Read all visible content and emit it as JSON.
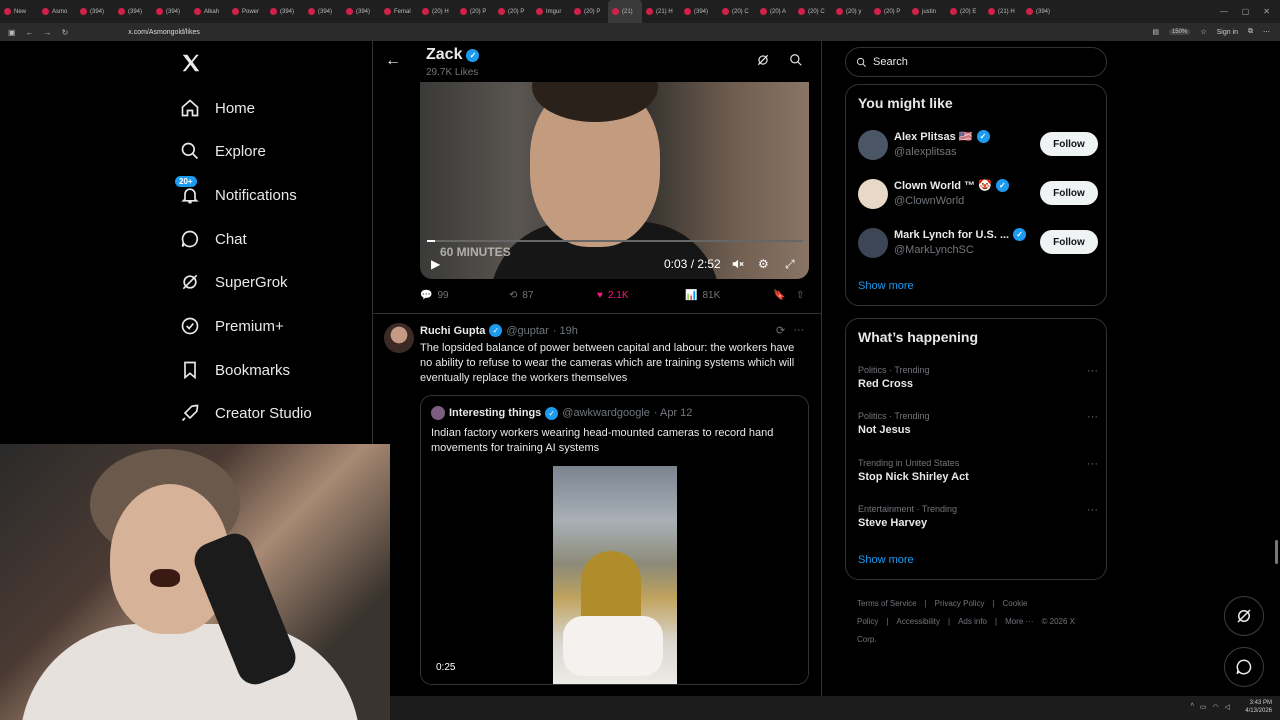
{
  "browser": {
    "tabs": [
      "New",
      "Asmo",
      "(394)",
      "(394)",
      "(394)",
      "Alkah",
      "Power",
      "(394)",
      "(394)",
      "(394)",
      "Femal",
      "(20) H",
      "(20) P",
      "(20) P",
      "Imgur",
      "(20) P",
      "(21)",
      "(21) H",
      "(394)",
      "(20) C",
      "(20) A",
      "(20) C",
      "(20) y",
      "(20) P",
      "justin",
      "(20) E",
      "(21) H",
      "(394)"
    ],
    "url": "x.com/Asmongold/likes",
    "zoom": "150%",
    "sign_in": "Sign in"
  },
  "sidebar": {
    "items": [
      {
        "label": "Home",
        "icon": "home-icon"
      },
      {
        "label": "Explore",
        "icon": "search-icon"
      },
      {
        "label": "Notifications",
        "icon": "bell-icon",
        "badge": "20+"
      },
      {
        "label": "Chat",
        "icon": "chat-icon"
      },
      {
        "label": "SuperGrok",
        "icon": "grok-icon"
      },
      {
        "label": "Premium+",
        "icon": "premium-icon"
      },
      {
        "label": "Bookmarks",
        "icon": "bookmark-icon"
      },
      {
        "label": "Creator Studio",
        "icon": "rocket-icon"
      }
    ]
  },
  "header": {
    "name": "Zack",
    "subtitle": "29.7K Likes"
  },
  "video1": {
    "time": "0:03 / 2:52",
    "watermark": "60 MINUTES",
    "progress": 0.02
  },
  "tweet1_actions": {
    "replies": "99",
    "reposts": "87",
    "likes": "2.1K",
    "views": "81K"
  },
  "tweet2": {
    "name": "Ruchi Gupta",
    "handle": "@guptar",
    "time": "· 19h",
    "text": "The lopsided balance of power between capital and labour: the workers have no ability to refuse to wear the cameras which are training systems which will eventually replace the workers themselves",
    "quote": {
      "name": "Interesting things",
      "handle": "@awkwardgoogle",
      "time": "· Apr 12",
      "text": "Indian factory workers wearing head-mounted cameras to record hand movements for training AI systems",
      "video_time": "0:25"
    }
  },
  "right": {
    "search_placeholder": "Search",
    "you_might_like": "You might like",
    "suggestions": [
      {
        "name": "Alex Plitsas 🇺🇸",
        "handle": "@alexplitsas",
        "follow": "Follow",
        "avatar_color": "#4a5565"
      },
      {
        "name": "Clown World ™ 🤡",
        "handle": "@ClownWorld",
        "follow": "Follow",
        "avatar_color": "#e8d9c6"
      },
      {
        "name": "Mark Lynch for U.S. ...",
        "handle": "@MarkLynchSC",
        "follow": "Follow",
        "avatar_color": "#3c4656"
      }
    ],
    "show_more": "Show more",
    "whats_happening": "What’s happening",
    "trends": [
      {
        "category": "Politics · Trending",
        "topic": "Red Cross"
      },
      {
        "category": "Politics · Trending",
        "topic": "Not Jesus"
      },
      {
        "category": "Trending in United States",
        "topic": "Stop Nick Shirley Act"
      },
      {
        "category": "Entertainment · Trending",
        "topic": "Steve Harvey"
      }
    ],
    "show_more_2": "Show more",
    "footer": [
      "Terms of Service",
      "|",
      "Privacy Policy",
      "|",
      "Cookie Policy",
      "|",
      "Accessibility",
      "|",
      "Ads info",
      "|",
      "More ···",
      "© 2026 X Corp."
    ]
  },
  "taskbar": {
    "time": "3:43 PM",
    "date": "4/13/2026"
  },
  "colors": {
    "accent": "#1d9bf0",
    "like": "#f91880",
    "border": "#2f3336",
    "muted": "#71767b"
  }
}
